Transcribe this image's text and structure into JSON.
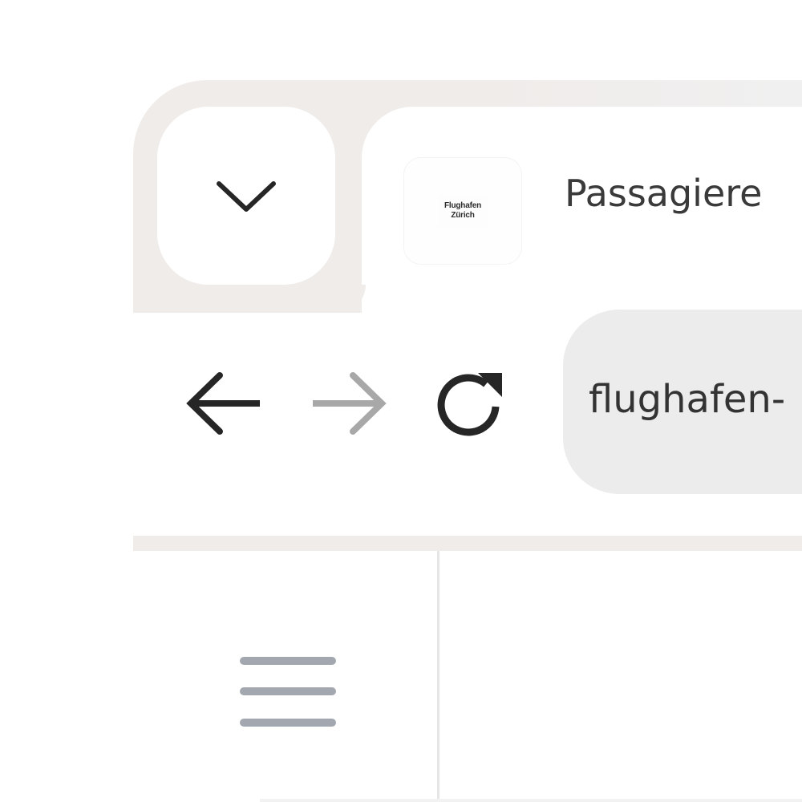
{
  "tab": {
    "title": "Passagiere",
    "favicon_text_line1": "Flughafen",
    "favicon_text_line2": "Zürich",
    "menu_icon": "chevron-down-icon"
  },
  "toolbar": {
    "back_icon": "arrow-left-icon",
    "forward_icon": "arrow-right-icon",
    "reload_icon": "reload-icon",
    "address": "flughafen-"
  },
  "page": {
    "menu_icon": "hamburger-menu-icon"
  },
  "colors": {
    "tabstrip": "#f0ecea",
    "omnibox": "#ececec",
    "icon_active": "#262626",
    "icon_disabled": "#a8a8a8",
    "hamburger": "#a3a8b0"
  }
}
